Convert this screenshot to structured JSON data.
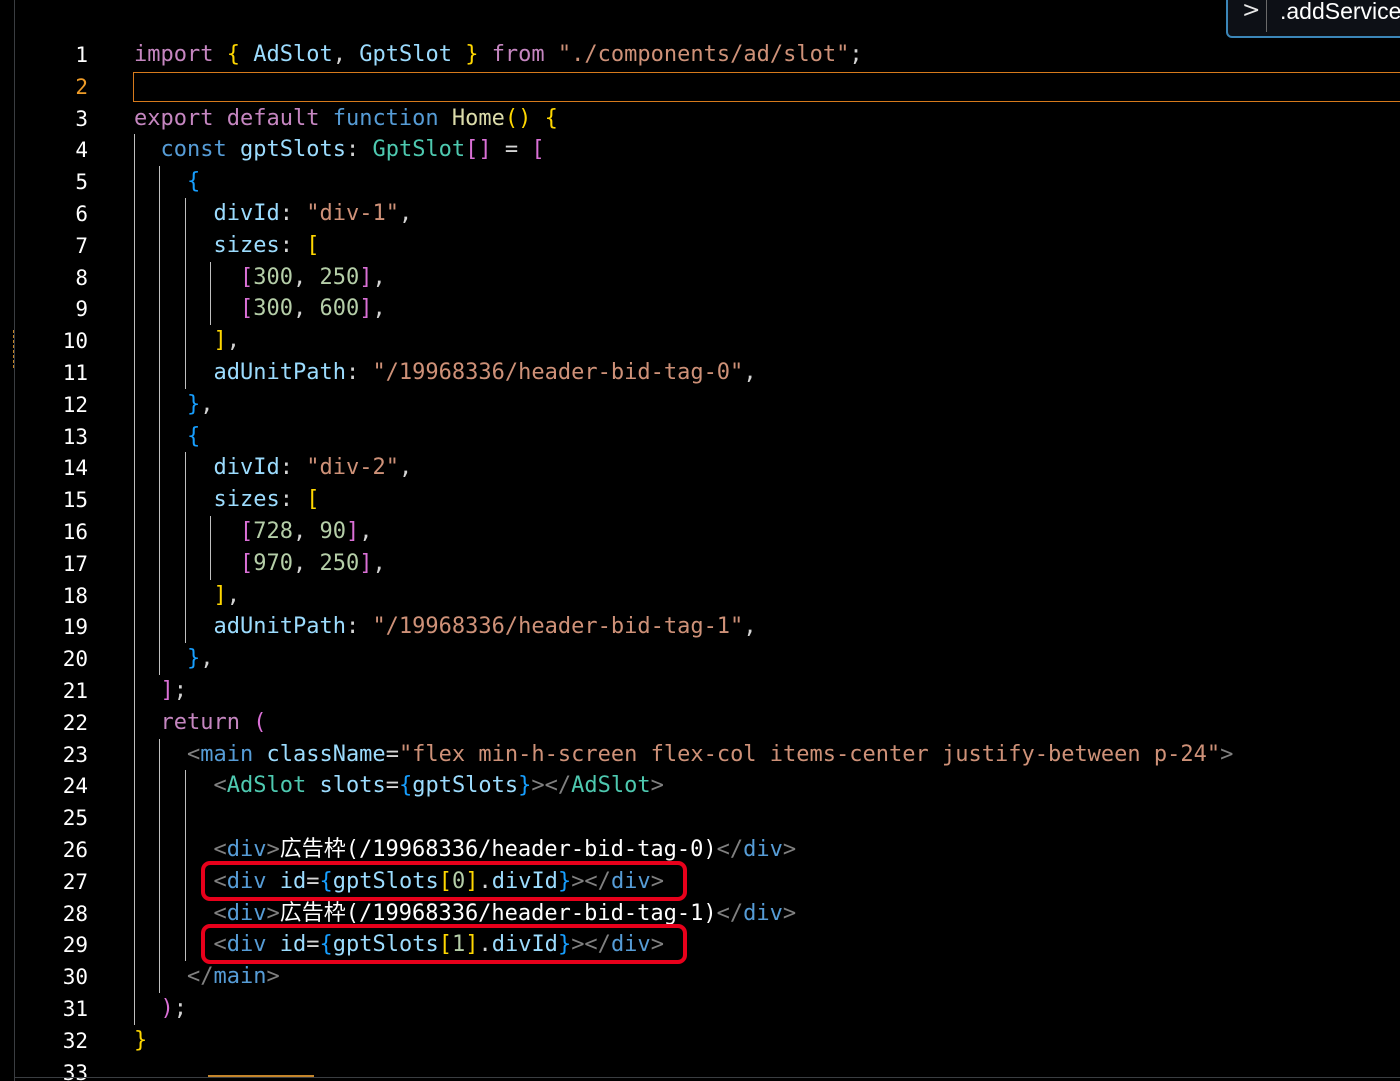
{
  "editor": {
    "breadcrumb": {
      "chevron": ">",
      "symbol": ".addService"
    },
    "active_line": 2,
    "line_numbers": [
      "1",
      "2",
      "3",
      "4",
      "5",
      "6",
      "7",
      "8",
      "9",
      "10",
      "11",
      "12",
      "13",
      "14",
      "15",
      "16",
      "17",
      "18",
      "19",
      "20",
      "21",
      "22",
      "23",
      "24",
      "25",
      "26",
      "27",
      "28",
      "29",
      "30",
      "31",
      "32",
      "33"
    ],
    "lines": [
      [
        [
          "kw",
          "import"
        ],
        [
          "pu",
          " "
        ],
        [
          "b1",
          "{"
        ],
        [
          "pu",
          " "
        ],
        [
          "va",
          "AdSlot"
        ],
        [
          "pu",
          ", "
        ],
        [
          "va",
          "GptSlot"
        ],
        [
          "pu",
          " "
        ],
        [
          "b1",
          "}"
        ],
        [
          "pu",
          " "
        ],
        [
          "kw",
          "from"
        ],
        [
          "pu",
          " "
        ],
        [
          "st",
          "\"./components/ad/slot\""
        ],
        [
          "pu",
          ";"
        ]
      ],
      [],
      [
        [
          "kw",
          "export"
        ],
        [
          "pu",
          " "
        ],
        [
          "kw",
          "default"
        ],
        [
          "pu",
          " "
        ],
        [
          "kb",
          "function"
        ],
        [
          "pu",
          " "
        ],
        [
          "fn",
          "Home"
        ],
        [
          "b1",
          "()"
        ],
        [
          "pu",
          " "
        ],
        [
          "b1",
          "{"
        ]
      ],
      [
        [
          "pu",
          "  "
        ],
        [
          "kb",
          "const"
        ],
        [
          "pu",
          " "
        ],
        [
          "va",
          "gptSlots"
        ],
        [
          "pu",
          ": "
        ],
        [
          "ty",
          "GptSlot"
        ],
        [
          "b2",
          "[]"
        ],
        [
          "pu",
          " = "
        ],
        [
          "b2",
          "["
        ]
      ],
      [
        [
          "pu",
          "    "
        ],
        [
          "b3",
          "{"
        ]
      ],
      [
        [
          "pu",
          "      "
        ],
        [
          "va",
          "divId"
        ],
        [
          "pu",
          ": "
        ],
        [
          "st",
          "\"div-1\""
        ],
        [
          "pu",
          ","
        ]
      ],
      [
        [
          "pu",
          "      "
        ],
        [
          "va",
          "sizes"
        ],
        [
          "pu",
          ": "
        ],
        [
          "b1",
          "["
        ]
      ],
      [
        [
          "pu",
          "        "
        ],
        [
          "b2",
          "["
        ],
        [
          "nu",
          "300"
        ],
        [
          "pu",
          ", "
        ],
        [
          "nu",
          "250"
        ],
        [
          "b2",
          "]"
        ],
        [
          "pu",
          ","
        ]
      ],
      [
        [
          "pu",
          "        "
        ],
        [
          "b2",
          "["
        ],
        [
          "nu",
          "300"
        ],
        [
          "pu",
          ", "
        ],
        [
          "nu",
          "600"
        ],
        [
          "b2",
          "]"
        ],
        [
          "pu",
          ","
        ]
      ],
      [
        [
          "pu",
          "      "
        ],
        [
          "b1",
          "]"
        ],
        [
          "pu",
          ","
        ]
      ],
      [
        [
          "pu",
          "      "
        ],
        [
          "va",
          "adUnitPath"
        ],
        [
          "pu",
          ": "
        ],
        [
          "st",
          "\"/19968336/header-bid-tag-0\""
        ],
        [
          "pu",
          ","
        ]
      ],
      [
        [
          "pu",
          "    "
        ],
        [
          "b3",
          "}"
        ],
        [
          "pu",
          ","
        ]
      ],
      [
        [
          "pu",
          "    "
        ],
        [
          "b3",
          "{"
        ]
      ],
      [
        [
          "pu",
          "      "
        ],
        [
          "va",
          "divId"
        ],
        [
          "pu",
          ": "
        ],
        [
          "st",
          "\"div-2\""
        ],
        [
          "pu",
          ","
        ]
      ],
      [
        [
          "pu",
          "      "
        ],
        [
          "va",
          "sizes"
        ],
        [
          "pu",
          ": "
        ],
        [
          "b1",
          "["
        ]
      ],
      [
        [
          "pu",
          "        "
        ],
        [
          "b2",
          "["
        ],
        [
          "nu",
          "728"
        ],
        [
          "pu",
          ", "
        ],
        [
          "nu",
          "90"
        ],
        [
          "b2",
          "]"
        ],
        [
          "pu",
          ","
        ]
      ],
      [
        [
          "pu",
          "        "
        ],
        [
          "b2",
          "["
        ],
        [
          "nu",
          "970"
        ],
        [
          "pu",
          ", "
        ],
        [
          "nu",
          "250"
        ],
        [
          "b2",
          "]"
        ],
        [
          "pu",
          ","
        ]
      ],
      [
        [
          "pu",
          "      "
        ],
        [
          "b1",
          "]"
        ],
        [
          "pu",
          ","
        ]
      ],
      [
        [
          "pu",
          "      "
        ],
        [
          "va",
          "adUnitPath"
        ],
        [
          "pu",
          ": "
        ],
        [
          "st",
          "\"/19968336/header-bid-tag-1\""
        ],
        [
          "pu",
          ","
        ]
      ],
      [
        [
          "pu",
          "    "
        ],
        [
          "b3",
          "}"
        ],
        [
          "pu",
          ","
        ]
      ],
      [
        [
          "pu",
          "  "
        ],
        [
          "b2",
          "]"
        ],
        [
          "pu",
          ";"
        ]
      ],
      [
        [
          "pu",
          "  "
        ],
        [
          "kw",
          "return"
        ],
        [
          "pu",
          " "
        ],
        [
          "b2",
          "("
        ]
      ],
      [
        [
          "pu",
          "    "
        ],
        [
          "tg",
          "<"
        ],
        [
          "tn",
          "main"
        ],
        [
          "pu",
          " "
        ],
        [
          "at",
          "className"
        ],
        [
          "pu",
          "="
        ],
        [
          "st",
          "\"flex min-h-screen flex-col items-center justify-between p-24\""
        ],
        [
          "tg",
          ">"
        ]
      ],
      [
        [
          "pu",
          "      "
        ],
        [
          "tg",
          "<"
        ],
        [
          "cm",
          "AdSlot"
        ],
        [
          "pu",
          " "
        ],
        [
          "at",
          "slots"
        ],
        [
          "pu",
          "="
        ],
        [
          "b3",
          "{"
        ],
        [
          "va",
          "gptSlots"
        ],
        [
          "b3",
          "}"
        ],
        [
          "tg",
          "></"
        ],
        [
          "cm",
          "AdSlot"
        ],
        [
          "tg",
          ">"
        ]
      ],
      [],
      [
        [
          "pu",
          "      "
        ],
        [
          "tg",
          "<"
        ],
        [
          "tn",
          "div"
        ],
        [
          "tg",
          ">"
        ],
        [
          "tx",
          "広告枠(/19968336/header-bid-tag-0)"
        ],
        [
          "tg",
          "</"
        ],
        [
          "tn",
          "div"
        ],
        [
          "tg",
          ">"
        ]
      ],
      [
        [
          "pu",
          "      "
        ],
        [
          "tg",
          "<"
        ],
        [
          "tn",
          "div"
        ],
        [
          "pu",
          " "
        ],
        [
          "at",
          "id"
        ],
        [
          "pu",
          "="
        ],
        [
          "b3",
          "{"
        ],
        [
          "va",
          "gptSlots"
        ],
        [
          "b1",
          "["
        ],
        [
          "nu",
          "0"
        ],
        [
          "b1",
          "]"
        ],
        [
          "pu",
          "."
        ],
        [
          "va",
          "divId"
        ],
        [
          "b3",
          "}"
        ],
        [
          "tg",
          "></"
        ],
        [
          "tn",
          "div"
        ],
        [
          "tg",
          ">"
        ]
      ],
      [
        [
          "pu",
          "      "
        ],
        [
          "tg",
          "<"
        ],
        [
          "tn",
          "div"
        ],
        [
          "tg",
          ">"
        ],
        [
          "tx",
          "広告枠(/19968336/header-bid-tag-1)"
        ],
        [
          "tg",
          "</"
        ],
        [
          "tn",
          "div"
        ],
        [
          "tg",
          ">"
        ]
      ],
      [
        [
          "pu",
          "      "
        ],
        [
          "tg",
          "<"
        ],
        [
          "tn",
          "div"
        ],
        [
          "pu",
          " "
        ],
        [
          "at",
          "id"
        ],
        [
          "pu",
          "="
        ],
        [
          "b3",
          "{"
        ],
        [
          "va",
          "gptSlots"
        ],
        [
          "b1",
          "["
        ],
        [
          "nu",
          "1"
        ],
        [
          "b1",
          "]"
        ],
        [
          "pu",
          "."
        ],
        [
          "va",
          "divId"
        ],
        [
          "b3",
          "}"
        ],
        [
          "tg",
          "></"
        ],
        [
          "tn",
          "div"
        ],
        [
          "tg",
          ">"
        ]
      ],
      [
        [
          "pu",
          "    "
        ],
        [
          "tg",
          "</"
        ],
        [
          "tn",
          "main"
        ],
        [
          "tg",
          ">"
        ]
      ],
      [
        [
          "pu",
          "  "
        ],
        [
          "b2",
          ")"
        ],
        [
          "pu",
          ";"
        ]
      ],
      [
        [
          "b1",
          "}"
        ]
      ],
      []
    ],
    "highlighted_lines": [
      27,
      29
    ],
    "indent_guides": [
      {
        "col": 0,
        "from": 4,
        "to": 31
      },
      {
        "col": 2,
        "from": 5,
        "to": 20
      },
      {
        "col": 4,
        "from": 6,
        "to": 11
      },
      {
        "col": 6,
        "from": 8,
        "to": 9
      },
      {
        "col": 4,
        "from": 14,
        "to": 19
      },
      {
        "col": 6,
        "from": 16,
        "to": 17
      },
      {
        "col": 2,
        "from": 23,
        "to": 30
      },
      {
        "col": 4,
        "from": 24,
        "to": 29
      }
    ]
  }
}
